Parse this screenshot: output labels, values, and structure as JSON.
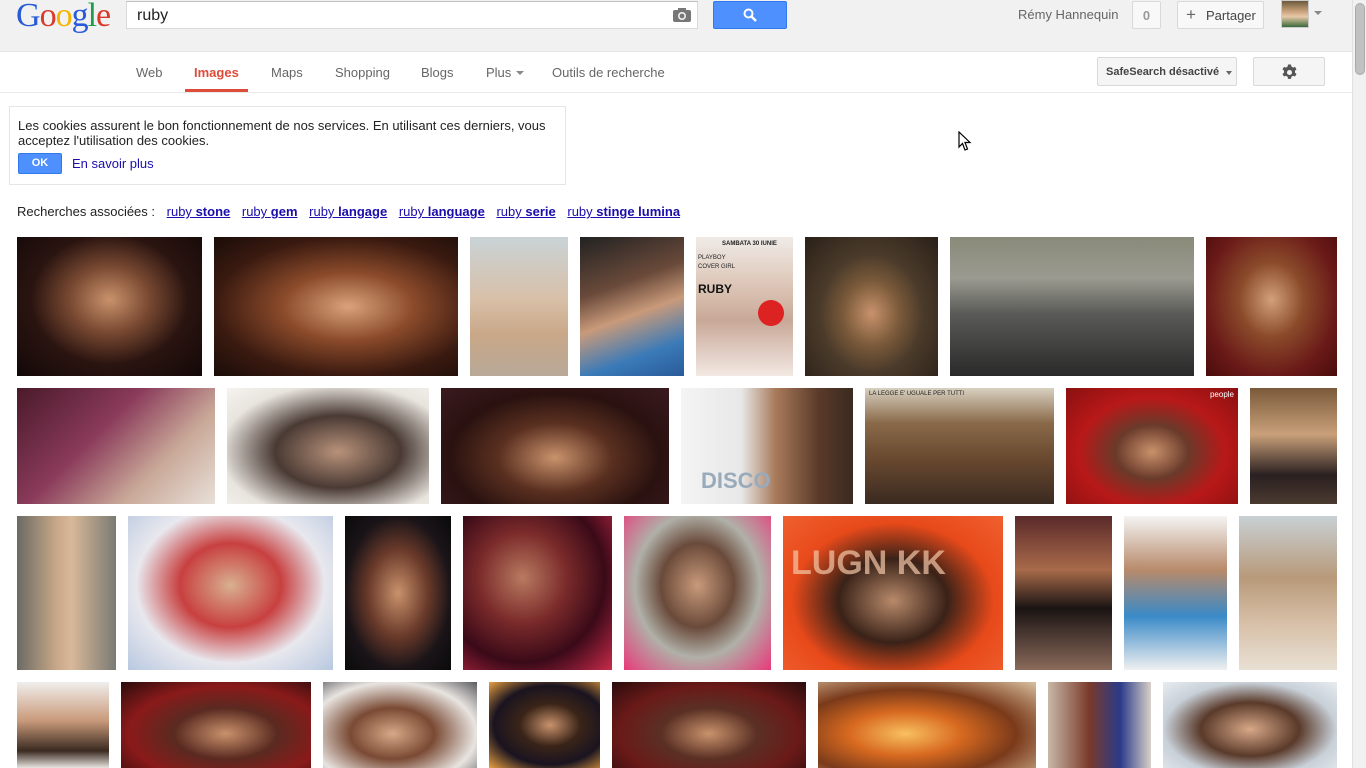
{
  "logo": {
    "letters": [
      "G",
      "o",
      "o",
      "g",
      "l",
      "e"
    ],
    "colors": [
      "#2a5bd7",
      "#d93a2b",
      "#f4b400",
      "#2a5bd7",
      "#1f9d4c",
      "#d93a2b"
    ]
  },
  "search": {
    "query": "ruby"
  },
  "user": {
    "name": "Rémy Hannequin",
    "notifications": "0",
    "share_label": "Partager"
  },
  "nav": {
    "tabs": [
      {
        "label": "Web"
      },
      {
        "label": "Images"
      },
      {
        "label": "Maps"
      },
      {
        "label": "Shopping"
      },
      {
        "label": "Blogs"
      },
      {
        "label": "Plus"
      },
      {
        "label": "Outils de recherche"
      }
    ],
    "active_tab": "Images",
    "safesearch_label": "SafeSearch désactivé"
  },
  "cookie": {
    "text": "Les cookies assurent le bon fonctionnement de nos services. En utilisant ces derniers, vous acceptez l'utilisation des cookies.",
    "ok_label": "OK",
    "more_label": "En savoir plus"
  },
  "related": {
    "label": "Recherches associées :",
    "items": [
      {
        "prefix": "ruby",
        "bold": "stone"
      },
      {
        "prefix": "ruby",
        "bold": "gem"
      },
      {
        "prefix": "ruby",
        "bold": "langage"
      },
      {
        "prefix": "ruby",
        "bold": "language"
      },
      {
        "prefix": "ruby",
        "bold": "serie"
      },
      {
        "prefix": "ruby",
        "bold": "stinge lumina"
      }
    ]
  },
  "image_overlay_text": {
    "poster_top": "SAMBATA 30 IUNIE",
    "poster_brand": "PLAYBOY",
    "poster_sub": "COVER GIRL",
    "poster_name": "RUBY",
    "court_banner": "LA LEGGE E' UGUALE PER TUTTI",
    "disco_sign": "DISCO",
    "people_watermark": "people",
    "red_banner": "LUGN KK"
  },
  "colors": {
    "accent": "#4d90fe",
    "active_tab": "#dd4b39",
    "link": "#1a0dab"
  }
}
